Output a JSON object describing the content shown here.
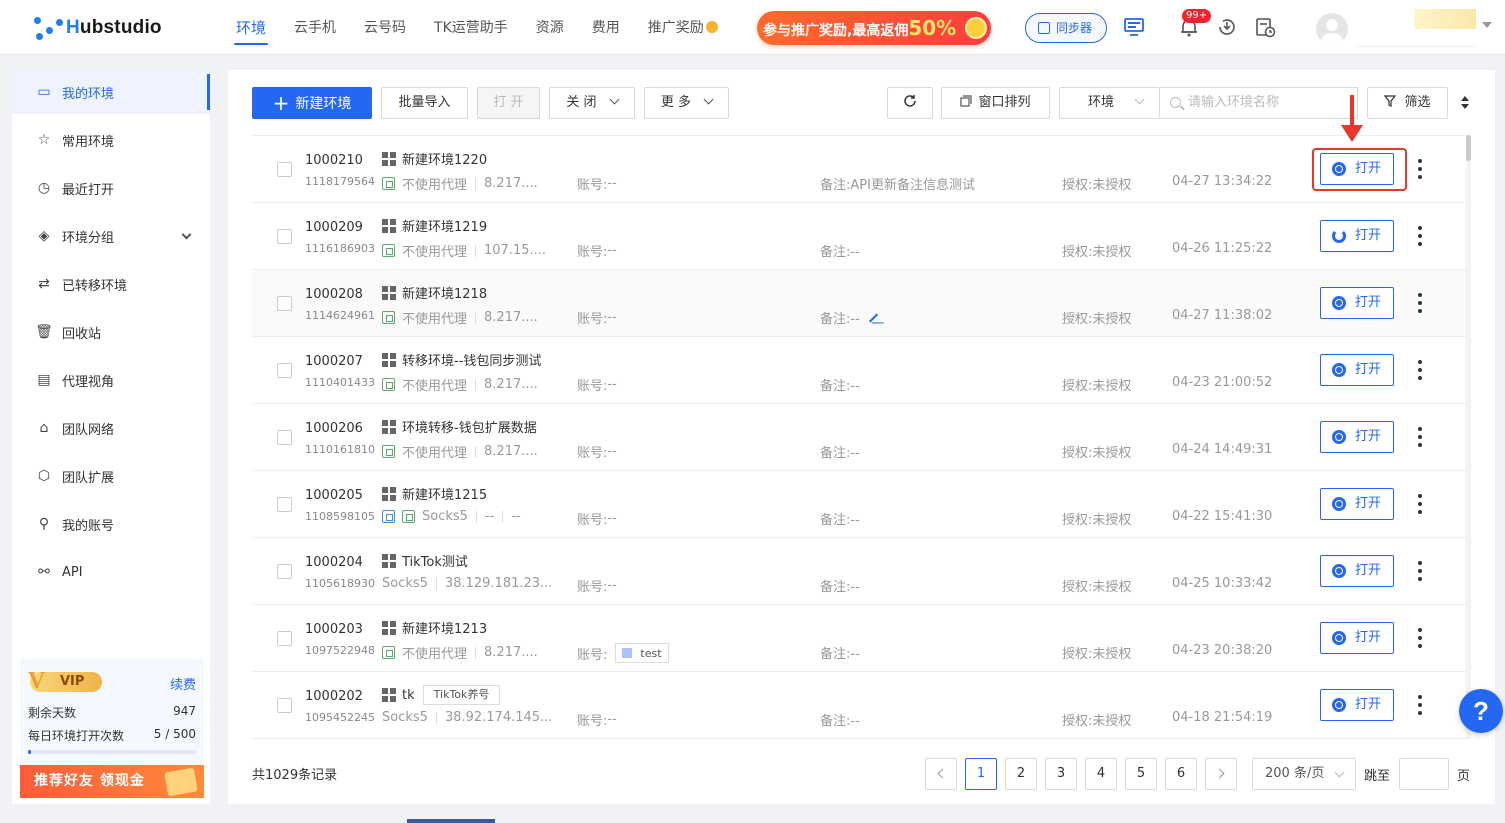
{
  "brand": {
    "name_prefix": "H",
    "name_rest": "ubstudio"
  },
  "nav": [
    {
      "label": "环境",
      "active": true
    },
    {
      "label": "云手机"
    },
    {
      "label": "云号码"
    },
    {
      "label": "TK运营助手"
    },
    {
      "label": "资源"
    },
    {
      "label": "费用"
    },
    {
      "label": "推广奖励"
    }
  ],
  "promo": {
    "text": "参与推广奖励,最高返佣",
    "percent": "50%"
  },
  "header": {
    "sync_label": "同步器",
    "notification_badge": "99+"
  },
  "sidebar": {
    "items": [
      {
        "label": "我的环境",
        "icon": "inbox-icon",
        "glyph": "▭",
        "active": true
      },
      {
        "label": "常用环境",
        "icon": "star-icon",
        "glyph": "☆"
      },
      {
        "label": "最近打开",
        "icon": "clock-icon",
        "glyph": "◷"
      },
      {
        "label": "环境分组",
        "icon": "layers-icon",
        "glyph": "◈"
      },
      {
        "label": "已转移环境",
        "icon": "transfer-icon",
        "glyph": "⇄"
      },
      {
        "label": "回收站",
        "icon": "trash-icon",
        "glyph": "🗑"
      },
      {
        "label": "代理视角",
        "icon": "proxy-view-icon",
        "glyph": "▤"
      },
      {
        "label": "团队网络",
        "icon": "team-network-icon",
        "glyph": "⌂"
      },
      {
        "label": "团队扩展",
        "icon": "cube-icon",
        "glyph": "⬡"
      },
      {
        "label": "我的账号",
        "icon": "user-icon",
        "glyph": "⚲"
      },
      {
        "label": "API",
        "icon": "plug-icon",
        "glyph": "⚯"
      }
    ]
  },
  "vip": {
    "badge": "VIP",
    "renew": "续费",
    "days_label": "剩余天数",
    "days_value": "947",
    "opens_label": "每日环境打开次数",
    "opens_value": "5 / 500",
    "opens_used": 5,
    "opens_total": 500,
    "refer": "推荐好友 领现金"
  },
  "toolbar": {
    "new_env": "新建环境",
    "batch_import": "批量导入",
    "open": "打 开",
    "close": "关 闭",
    "more": "更 多",
    "window_arrange": "窗口排列",
    "env_select": "环境",
    "search_placeholder": "请输入环境名称",
    "filter": "筛选"
  },
  "rows": [
    {
      "id": "1000210",
      "serial": "1118179564",
      "name": "新建环境1220",
      "proxy": "不使用代理",
      "ip": "8.217....",
      "account_label": "账号:",
      "account": "--",
      "remark": "备注:API更新备注信息测试",
      "auth": "授权:未授权",
      "time": "04-27 13:34:22",
      "open": "打开"
    },
    {
      "id": "1000209",
      "serial": "1116186903",
      "name": "新建环境1219",
      "proxy": "不使用代理",
      "ip": "107.15....",
      "account_label": "账号:",
      "account": "--",
      "remark": "备注:--",
      "auth": "授权:未授权",
      "time": "04-26 11:25:22",
      "open": "打开",
      "loading": true
    },
    {
      "id": "1000208",
      "serial": "1114624961",
      "name": "新建环境1218",
      "proxy": "不使用代理",
      "ip": "8.217....",
      "account_label": "账号:",
      "account": "--",
      "remark": "备注:--",
      "auth": "授权:未授权",
      "time": "04-27 11:38:02",
      "open": "打开",
      "editable": true,
      "alt": true
    },
    {
      "id": "1000207",
      "serial": "1110401433",
      "name": "转移环境--钱包同步测试",
      "proxy": "不使用代理",
      "ip": "8.217....",
      "account_label": "账号:",
      "account": "--",
      "remark": "备注:--",
      "auth": "授权:未授权",
      "time": "04-23 21:00:52",
      "open": "打开"
    },
    {
      "id": "1000206",
      "serial": "1110161810",
      "name": "环境转移-钱包扩展数据",
      "proxy": "不使用代理",
      "ip": "8.217....",
      "account_label": "账号:",
      "account": "--",
      "remark": "备注:--",
      "auth": "授权:未授权",
      "time": "04-24 14:49:31",
      "open": "打开"
    },
    {
      "id": "1000205",
      "serial": "1108598105",
      "name": "新建环境1215",
      "proxy": "Socks5",
      "ip": "--",
      "ip2": "--",
      "account_label": "账号:",
      "account": "--",
      "remark": "备注:--",
      "auth": "授权:未授权",
      "time": "04-22 15:41:30",
      "open": "打开",
      "double_icon": true
    },
    {
      "id": "1000204",
      "serial": "1105618930",
      "name": "TikTok测试",
      "proxy": "Socks5",
      "ip": "38.129.181.23...",
      "account_label": "账号:",
      "account": "--",
      "remark": "备注:--",
      "auth": "授权:未授权",
      "time": "04-25 10:33:42",
      "open": "打开",
      "no_icon": true
    },
    {
      "id": "1000203",
      "serial": "1097522948",
      "name": "新建环境1213",
      "proxy": "不使用代理",
      "ip": "8.217....",
      "account_label": "账号:",
      "account_tag": "test",
      "remark": "备注:--",
      "auth": "授权:未授权",
      "time": "04-23 20:38:20",
      "open": "打开"
    },
    {
      "id": "1000202",
      "serial": "1095452245",
      "name": "tk",
      "tag": "TikTok养号",
      "proxy": "Socks5",
      "ip": "38.92.174.145...",
      "account_label": "账号:",
      "account": "--",
      "remark": "备注:--",
      "auth": "授权:未授权",
      "time": "04-18 21:54:19",
      "open": "打开",
      "no_icon": true
    }
  ],
  "pagination": {
    "total": "共1029条记录",
    "pages": [
      "1",
      "2",
      "3",
      "4",
      "5",
      "6"
    ],
    "current": "1",
    "page_size": "200 条/页",
    "jump_label": "跳至",
    "page_label": "页"
  },
  "help": "?",
  "colors": {
    "primary": "#2468f2",
    "highlight": "#e8362b",
    "promo": "#ff3d3d"
  }
}
